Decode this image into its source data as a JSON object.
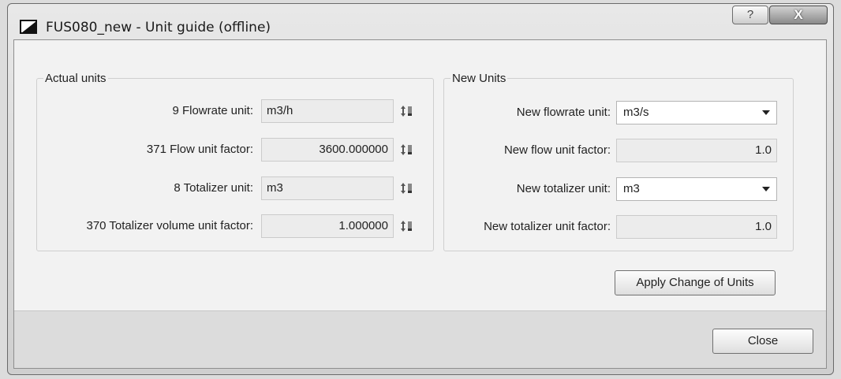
{
  "window": {
    "title": "FUS080_new - Unit guide (offline)",
    "help_label": "?",
    "close_glyph": "X"
  },
  "actual_units": {
    "title": "Actual units",
    "rows": [
      {
        "label": "9  Flowrate unit:",
        "value": "m3/h"
      },
      {
        "label": "371  Flow unit factor:",
        "value": "3600.000000"
      },
      {
        "label": "8  Totalizer unit:",
        "value": "m3"
      },
      {
        "label": "370  Totalizer volume unit factor:",
        "value": "1.000000"
      }
    ]
  },
  "new_units": {
    "title": "New Units",
    "rows": [
      {
        "label": "New flowrate unit:",
        "value": "m3/s"
      },
      {
        "label": "New flow unit factor:",
        "value": "1.0"
      },
      {
        "label": "New totalizer unit:",
        "value": "m3"
      },
      {
        "label": "New totalizer unit factor:",
        "value": "1.0"
      }
    ]
  },
  "apply_button": "Apply Change of Units",
  "close_button": "Close"
}
